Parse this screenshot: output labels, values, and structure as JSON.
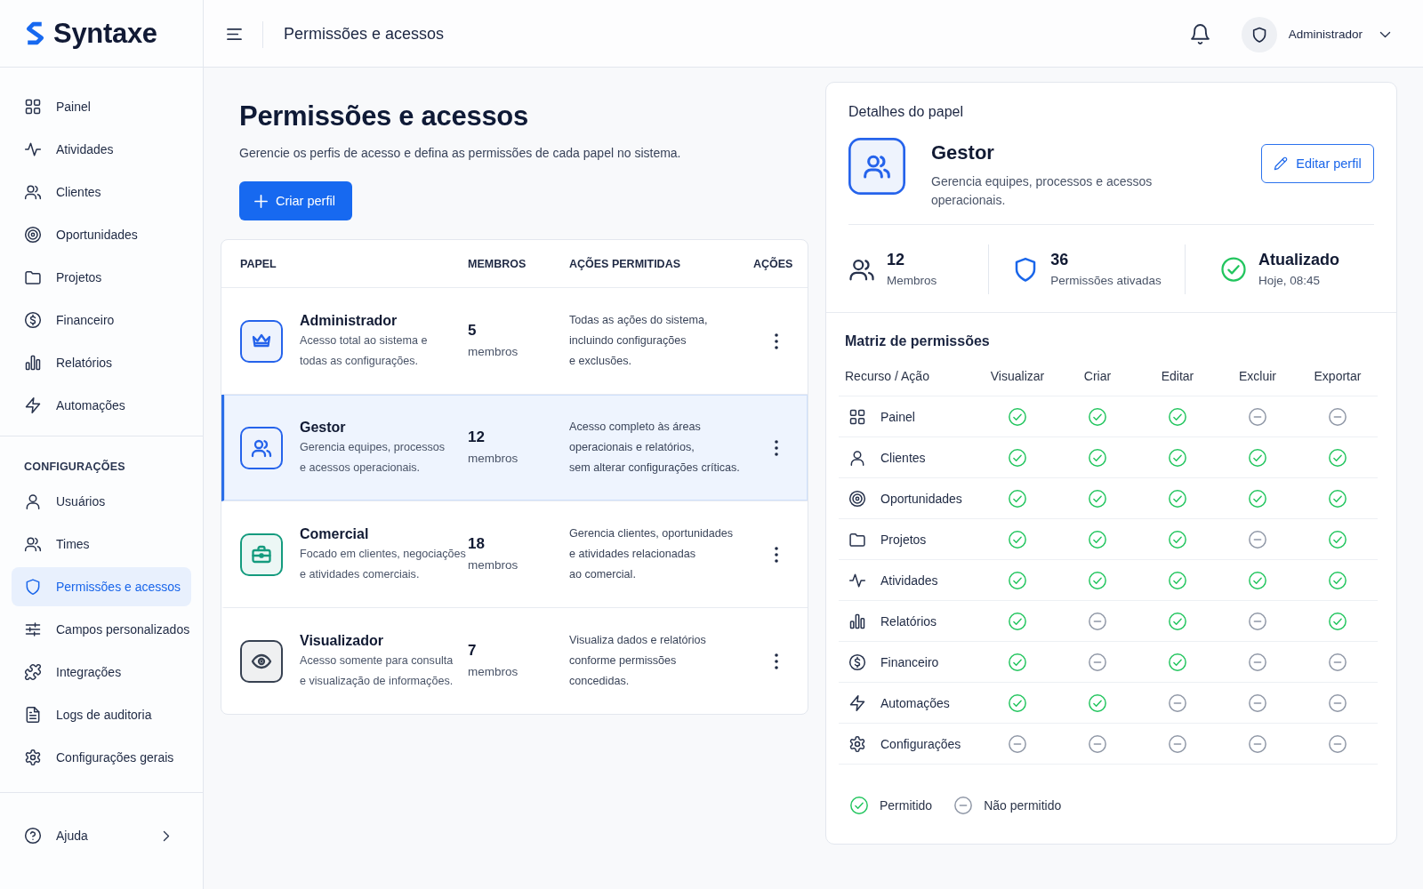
{
  "brand": {
    "name": "Syntaxe"
  },
  "sidebar": {
    "main_items": [
      {
        "label": "Painel",
        "selected": false
      },
      {
        "label": "Atividades",
        "selected": false
      },
      {
        "label": "Clientes",
        "selected": false
      },
      {
        "label": "Oportunidades",
        "selected": false
      },
      {
        "label": "Projetos",
        "selected": false
      },
      {
        "label": "Financeiro",
        "selected": false
      },
      {
        "label": "Relatórios",
        "selected": false
      },
      {
        "label": "Automações",
        "selected": false
      }
    ],
    "section_title": "CONFIGURAÇÕES",
    "settings_items": [
      {
        "label": "Usuários",
        "selected": false
      },
      {
        "label": "Times",
        "selected": false
      },
      {
        "label": "Permissões e acessos",
        "selected": true
      },
      {
        "label": "Campos personalizados",
        "selected": false
      },
      {
        "label": "Integrações",
        "selected": false
      },
      {
        "label": "Logs de auditoria",
        "selected": false
      },
      {
        "label": "Configurações gerais",
        "selected": false
      }
    ],
    "help": {
      "label": "Ajuda"
    }
  },
  "topbar": {
    "title": "Permissões e acessos",
    "user_name": "Administrador"
  },
  "page": {
    "title": "Permissões e acessos",
    "subtitle": "Gerencie os perfis de acesso e defina as permissões de cada papel no sistema.",
    "create_button": "Criar perfil"
  },
  "roles_table": {
    "columns": [
      "PAPEL",
      "MEMBROS",
      "AÇÕES PERMITIDAS",
      "AÇÕES"
    ],
    "rows": [
      {
        "name": "Administrador",
        "description": "Acesso total ao sistema e\ntodas as configurações.",
        "members": "5",
        "members_label": "membros",
        "allowed_actions": "Todas as ações do sistema,\nincluindo configurações\ne exclusões.",
        "color": "#2563eb",
        "selected": false
      },
      {
        "name": "Gestor",
        "description": "Gerencia equipes, processos\ne acessos operacionais.",
        "members": "12",
        "members_label": "membros",
        "allowed_actions": "Acesso completo às áreas\noperacionais e relatórios,\nsem alterar configurações críticas.",
        "color": "#2563eb",
        "selected": true
      },
      {
        "name": "Comercial",
        "description": "Focado em clientes, negociações\ne atividades comerciais.",
        "members": "18",
        "members_label": "membros",
        "allowed_actions": "Gerencia clientes, oportunidades\ne atividades relacionadas\nao comercial.",
        "color": "#149b7e",
        "selected": false
      },
      {
        "name": "Visualizador",
        "description": "Acesso somente para consulta\ne visualização de informações.",
        "members": "7",
        "members_label": "membros",
        "allowed_actions": "Visualiza dados e relatórios\nconforme permissões\nconcedidas.",
        "color": "#374151",
        "selected": false
      }
    ]
  },
  "role_details": {
    "title": "Detalhes do papel",
    "name": "Gestor",
    "description": "Gerencia equipes, processos e acessos\noperacionais.",
    "edit_button": "Editar perfil",
    "stats": [
      {
        "value": "12",
        "label": "Membros"
      },
      {
        "value": "36",
        "label": "Permissões ativadas"
      },
      {
        "value": "Atualizado",
        "label": "Hoje, 08:45"
      }
    ]
  },
  "permission_matrix": {
    "title": "Matriz de permissões",
    "columns": [
      "Recurso / Ação",
      "Visualizar",
      "Criar",
      "Editar",
      "Excluir",
      "Exportar"
    ],
    "rows": [
      {
        "resource": "Painel",
        "permissions": [
          true,
          true,
          true,
          false,
          false
        ]
      },
      {
        "resource": "Clientes",
        "permissions": [
          true,
          true,
          true,
          true,
          true
        ]
      },
      {
        "resource": "Oportunidades",
        "permissions": [
          true,
          true,
          true,
          true,
          true
        ]
      },
      {
        "resource": "Projetos",
        "permissions": [
          true,
          true,
          true,
          false,
          true
        ]
      },
      {
        "resource": "Atividades",
        "permissions": [
          true,
          true,
          true,
          true,
          true
        ]
      },
      {
        "resource": "Relatórios",
        "permissions": [
          true,
          false,
          true,
          false,
          true
        ]
      },
      {
        "resource": "Financeiro",
        "permissions": [
          true,
          false,
          true,
          false,
          false
        ]
      },
      {
        "resource": "Automações",
        "permissions": [
          true,
          true,
          false,
          false,
          false
        ]
      },
      {
        "resource": "Configurações",
        "permissions": [
          false,
          false,
          false,
          false,
          false
        ]
      }
    ],
    "legend": [
      {
        "label": "Permitido",
        "allowed": true
      },
      {
        "label": "Não permitido",
        "allowed": false
      }
    ]
  }
}
